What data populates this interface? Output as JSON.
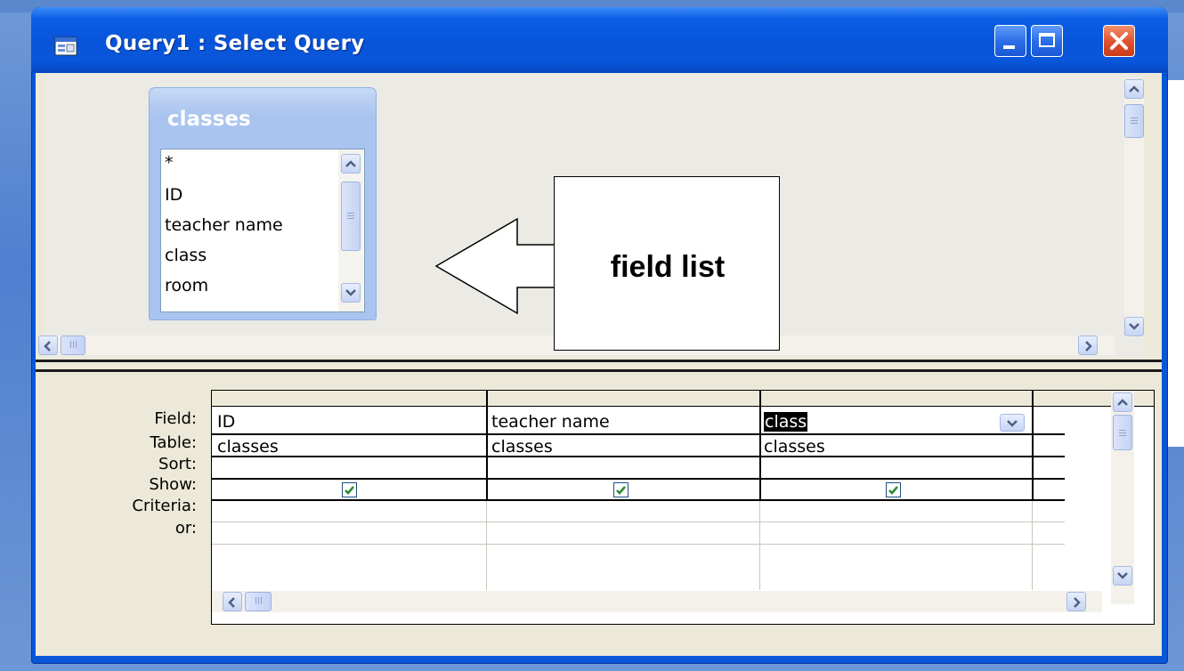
{
  "window": {
    "title": "Query1 : Select Query"
  },
  "field_list": {
    "table_name": "classes",
    "items": [
      "*",
      "ID",
      "teacher name",
      "class",
      "room"
    ]
  },
  "callout": {
    "text": "field list"
  },
  "design_grid": {
    "row_labels": [
      "Field:",
      "Table:",
      "Sort:",
      "Show:",
      "Criteria:",
      "or:"
    ],
    "columns": [
      {
        "field": "ID",
        "table": "classes",
        "sort": "",
        "show": true,
        "criteria": "",
        "or": ""
      },
      {
        "field": "teacher name",
        "table": "classes",
        "sort": "",
        "show": true,
        "criteria": "",
        "or": ""
      },
      {
        "field": "class",
        "table": "classes",
        "sort": "",
        "show": true,
        "criteria": "",
        "or": "",
        "selected": true
      }
    ]
  },
  "icons": {
    "app": "query-icon",
    "minimize": "minimize-icon",
    "maximize": "maximize-icon",
    "close": "close-icon",
    "check": "checkmark-icon"
  },
  "colors": {
    "titlebar": "#0754d9",
    "close_button": "#e2532e",
    "field_list_header": "#a9c4ef",
    "check": "#2a8a2a"
  }
}
